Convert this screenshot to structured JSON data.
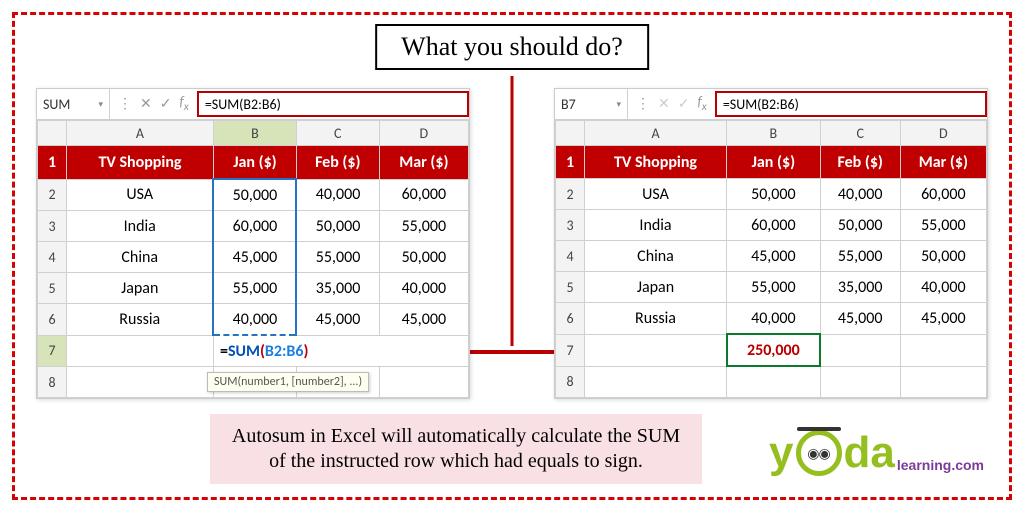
{
  "title": "What you should do?",
  "left": {
    "namebox": "SUM",
    "formula": "=SUM(B2:B6)",
    "columns": [
      "A",
      "B",
      "C",
      "D"
    ],
    "rows": [
      "1",
      "2",
      "3",
      "4",
      "5",
      "6",
      "7",
      "8"
    ],
    "headers": [
      "TV Shopping",
      "Jan ($)",
      "Feb ($)",
      "Mar ($)"
    ],
    "data": [
      [
        "USA",
        "50,000",
        "40,000",
        "60,000"
      ],
      [
        "India",
        "60,000",
        "50,000",
        "55,000"
      ],
      [
        "China",
        "45,000",
        "55,000",
        "50,000"
      ],
      [
        "Japan",
        "55,000",
        "35,000",
        "40,000"
      ],
      [
        "Russia",
        "40,000",
        "45,000",
        "45,000"
      ]
    ],
    "b7_eq": "=",
    "b7_fn": "SUM",
    "b7_po": "(",
    "b7_rg": "B2:B6",
    "b7_pc": ")",
    "hint": "SUM(number1, [number2], ...)"
  },
  "right": {
    "namebox": "B7",
    "formula": "=SUM(B2:B6)",
    "columns": [
      "A",
      "B",
      "C",
      "D"
    ],
    "rows": [
      "1",
      "2",
      "3",
      "4",
      "5",
      "6",
      "7",
      "8"
    ],
    "headers": [
      "TV Shopping",
      "Jan ($)",
      "Feb ($)",
      "Mar ($)"
    ],
    "data": [
      [
        "USA",
        "50,000",
        "40,000",
        "60,000"
      ],
      [
        "India",
        "60,000",
        "50,000",
        "55,000"
      ],
      [
        "China",
        "45,000",
        "55,000",
        "50,000"
      ],
      [
        "Japan",
        "55,000",
        "35,000",
        "40,000"
      ],
      [
        "Russia",
        "40,000",
        "45,000",
        "45,000"
      ]
    ],
    "b7": "250,000"
  },
  "caption": "Autosum in Excel will automatically calculate the SUM of the instructed row which had equals to sign.",
  "logo": {
    "y": "y",
    "da": "da",
    "sub": "learning.com",
    "glasses": "◉◉"
  },
  "chart_data": {
    "type": "table",
    "title": "TV Shopping monthly totals (USD)",
    "categories": [
      "USA",
      "India",
      "China",
      "Japan",
      "Russia"
    ],
    "series": [
      {
        "name": "Jan ($)",
        "values": [
          50000,
          60000,
          45000,
          55000,
          40000
        ]
      },
      {
        "name": "Feb ($)",
        "values": [
          40000,
          50000,
          55000,
          35000,
          45000
        ]
      },
      {
        "name": "Mar ($)",
        "values": [
          60000,
          55000,
          50000,
          40000,
          45000
        ]
      }
    ],
    "sums": {
      "Jan": 250000
    }
  }
}
